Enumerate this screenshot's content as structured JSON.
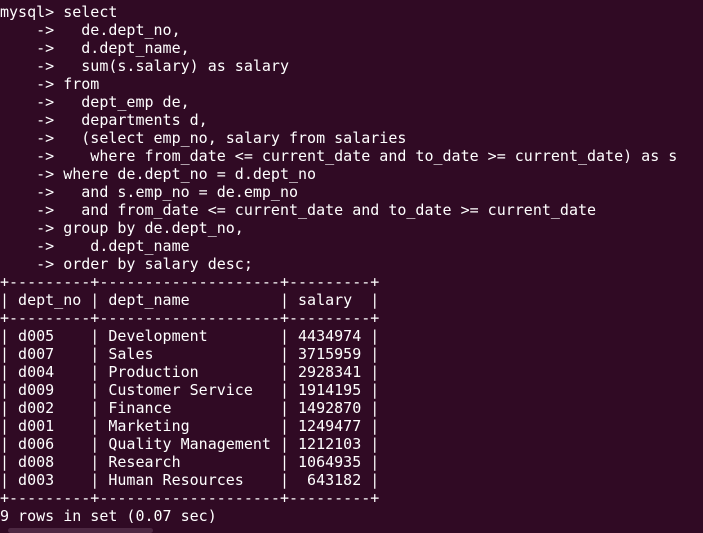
{
  "terminal": {
    "background": "#300a24",
    "foreground": "#ffffff",
    "query_lines": [
      "mysql> select",
      "    ->   de.dept_no,",
      "    ->   d.dept_name,",
      "    ->   sum(s.salary) as salary",
      "    -> from",
      "    ->   dept_emp de,",
      "    ->   departments d,",
      "    ->   (select emp_no, salary from salaries",
      "    ->    where from_date <= current_date and to_date >= current_date) as s",
      "    -> where de.dept_no = d.dept_no",
      "    ->   and s.emp_no = de.emp_no",
      "    ->   and from_date <= current_date and to_date >= current_date",
      "    -> group by de.dept_no,",
      "    ->    d.dept_name",
      "    -> order by salary desc;"
    ],
    "table": {
      "columns": [
        "dept_no",
        "dept_name",
        "salary"
      ],
      "rows": [
        [
          "d005",
          "Development",
          "4434974"
        ],
        [
          "d007",
          "Sales",
          "3715959"
        ],
        [
          "d004",
          "Production",
          "2928341"
        ],
        [
          "d009",
          "Customer Service",
          "1914195"
        ],
        [
          "d002",
          "Finance",
          "1492870"
        ],
        [
          "d001",
          "Marketing",
          "1249477"
        ],
        [
          "d006",
          "Quality Management",
          "1212103"
        ],
        [
          "d008",
          "Research",
          "1064935"
        ],
        [
          "d003",
          "Human Resources",
          "643182"
        ]
      ]
    },
    "result_status": "9 rows in set (0.07 sec)"
  }
}
